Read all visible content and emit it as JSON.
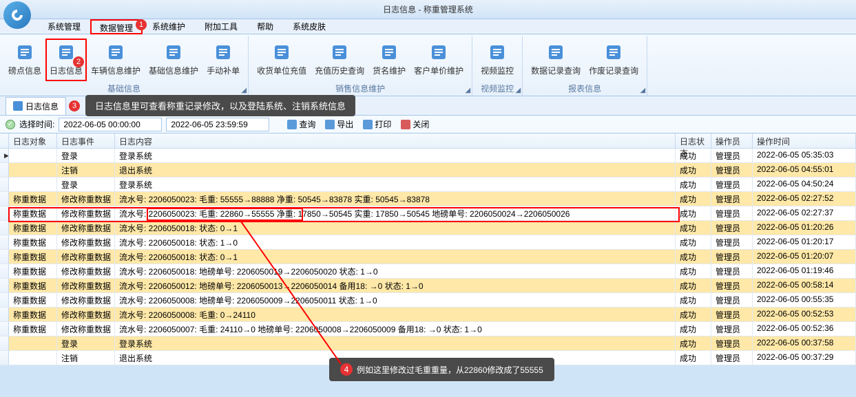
{
  "title": "日志信息 - 称重管理系统",
  "menu": [
    "系统管理",
    "数据管理",
    "系统维护",
    "附加工具",
    "帮助",
    "系统皮肤"
  ],
  "menu_hi_idx": 1,
  "ribbon": {
    "btns": [
      {
        "lbl": "磅点信息",
        "grp": 0,
        "c": "#4a90d9"
      },
      {
        "lbl": "日志信息",
        "grp": 0,
        "c": "#4a90d9",
        "hi": true
      },
      {
        "lbl": "车辆信息维护",
        "grp": 0,
        "c": "#4a90d9"
      },
      {
        "lbl": "基础信息维护",
        "grp": 0,
        "c": "#4a90d9"
      },
      {
        "lbl": "手动补单",
        "grp": 0,
        "c": "#4a90d9"
      },
      {
        "lbl": "收货单位充值",
        "grp": 1,
        "c": "#4a90d9"
      },
      {
        "lbl": "充值历史查询",
        "grp": 1,
        "c": "#4a90d9"
      },
      {
        "lbl": "货名维护",
        "grp": 1,
        "c": "#4a90d9"
      },
      {
        "lbl": "客户单价维护",
        "grp": 1,
        "c": "#4a90d9"
      },
      {
        "lbl": "视频监控",
        "grp": 2,
        "c": "#4a90d9"
      },
      {
        "lbl": "数据记录查询",
        "grp": 3,
        "c": "#4a90d9"
      },
      {
        "lbl": "作废记录查询",
        "grp": 3,
        "c": "#4a90d9"
      }
    ],
    "groups": [
      "基础信息",
      "销售信息维护",
      "视频监控",
      "报表信息"
    ]
  },
  "tab": {
    "label": "日志信息"
  },
  "tooltip3": "日志信息里可查看称重记录修改，以及登陆系统、注销系统信息",
  "toolbar": {
    "label": "选择时间:",
    "d1": "2022-06-05 00:00:00",
    "d2": "2022-06-05 23:59:59",
    "query": "查询",
    "export": "导出",
    "print": "打印",
    "close": "关闭"
  },
  "cols": [
    "日志对象",
    "日志事件",
    "日志内容",
    "日志状态",
    "操作员",
    "操作时间"
  ],
  "rows": [
    {
      "y": 0,
      "mk": 1,
      "o": "",
      "e": "登录",
      "c": "登录系统",
      "s": "成功",
      "p": "管理员",
      "t": "2022-06-05 05:35:03"
    },
    {
      "y": 1,
      "o": "",
      "e": "注销",
      "c": "退出系统",
      "s": "成功",
      "p": "管理员",
      "t": "2022-06-05 04:55:01"
    },
    {
      "y": 0,
      "o": "",
      "e": "登录",
      "c": "登录系统",
      "s": "成功",
      "p": "管理员",
      "t": "2022-06-05 04:50:24"
    },
    {
      "y": 1,
      "o": "称重数据",
      "e": "修改称重数据",
      "c": "流水号:  2206050023:  毛重:   55555→88888    净重:   50545→83878    实重:   50545→83878",
      "s": "成功",
      "p": "管理员",
      "t": "2022-06-05 02:27:52"
    },
    {
      "y": 0,
      "o": "称重数据",
      "e": "修改称重数据",
      "c": "流水号:  2206050023:  毛重:   22860→55555    净重:   17850→50545    实重:   17850→50545    地磅单号:   2206050024→2206050026",
      "s": "成功",
      "p": "管理员",
      "t": "2022-06-05 02:27:37",
      "hi": 1
    },
    {
      "y": 1,
      "o": "称重数据",
      "e": "修改称重数据",
      "c": "流水号:  2206050018:  状态:   0→1",
      "s": "成功",
      "p": "管理员",
      "t": "2022-06-05 01:20:26"
    },
    {
      "y": 0,
      "o": "称重数据",
      "e": "修改称重数据",
      "c": "流水号:  2206050018:  状态:   1→0",
      "s": "成功",
      "p": "管理员",
      "t": "2022-06-05 01:20:17"
    },
    {
      "y": 1,
      "o": "称重数据",
      "e": "修改称重数据",
      "c": "流水号:  2206050018:  状态:   0→1",
      "s": "成功",
      "p": "管理员",
      "t": "2022-06-05 01:20:07"
    },
    {
      "y": 0,
      "o": "称重数据",
      "e": "修改称重数据",
      "c": "流水号:  2206050018:  地磅单号:   2206050019→2206050020    状态:   1→0",
      "s": "成功",
      "p": "管理员",
      "t": "2022-06-05 01:19:46"
    },
    {
      "y": 1,
      "o": "称重数据",
      "e": "修改称重数据",
      "c": "流水号:  2206050012:  地磅单号:   2206050013→2206050014    备用18:   →0    状态:   1→0",
      "s": "成功",
      "p": "管理员",
      "t": "2022-06-05 00:58:14"
    },
    {
      "y": 0,
      "o": "称重数据",
      "e": "修改称重数据",
      "c": "流水号:  2206050008:  地磅单号:   2206050009→2206050011    状态:   1→0",
      "s": "成功",
      "p": "管理员",
      "t": "2022-06-05 00:55:35"
    },
    {
      "y": 1,
      "o": "称重数据",
      "e": "修改称重数据",
      "c": "流水号:  2206050008:  毛重:   0→24110",
      "s": "成功",
      "p": "管理员",
      "t": "2022-06-05 00:52:53"
    },
    {
      "y": 0,
      "o": "称重数据",
      "e": "修改称重数据",
      "c": "流水号:  2206050007:  毛重:   24110→0    地磅单号:   2206050008→2206050009    备用18:   →0    状态:   1→0",
      "s": "成功",
      "p": "管理员",
      "t": "2022-06-05 00:52:36"
    },
    {
      "y": 1,
      "o": "",
      "e": "登录",
      "c": "登录系统",
      "s": "成功",
      "p": "管理员",
      "t": "2022-06-05 00:37:58"
    },
    {
      "y": 0,
      "o": "",
      "e": "注销",
      "c": "退出系统",
      "s": "成功",
      "p": "管理员",
      "t": "2022-06-05 00:37:29"
    }
  ],
  "callout4": "例如这里修改过毛重重量，从22860修改成了55555",
  "badges": {
    "b1": "1",
    "b2": "2",
    "b3": "3",
    "b4": "4"
  }
}
